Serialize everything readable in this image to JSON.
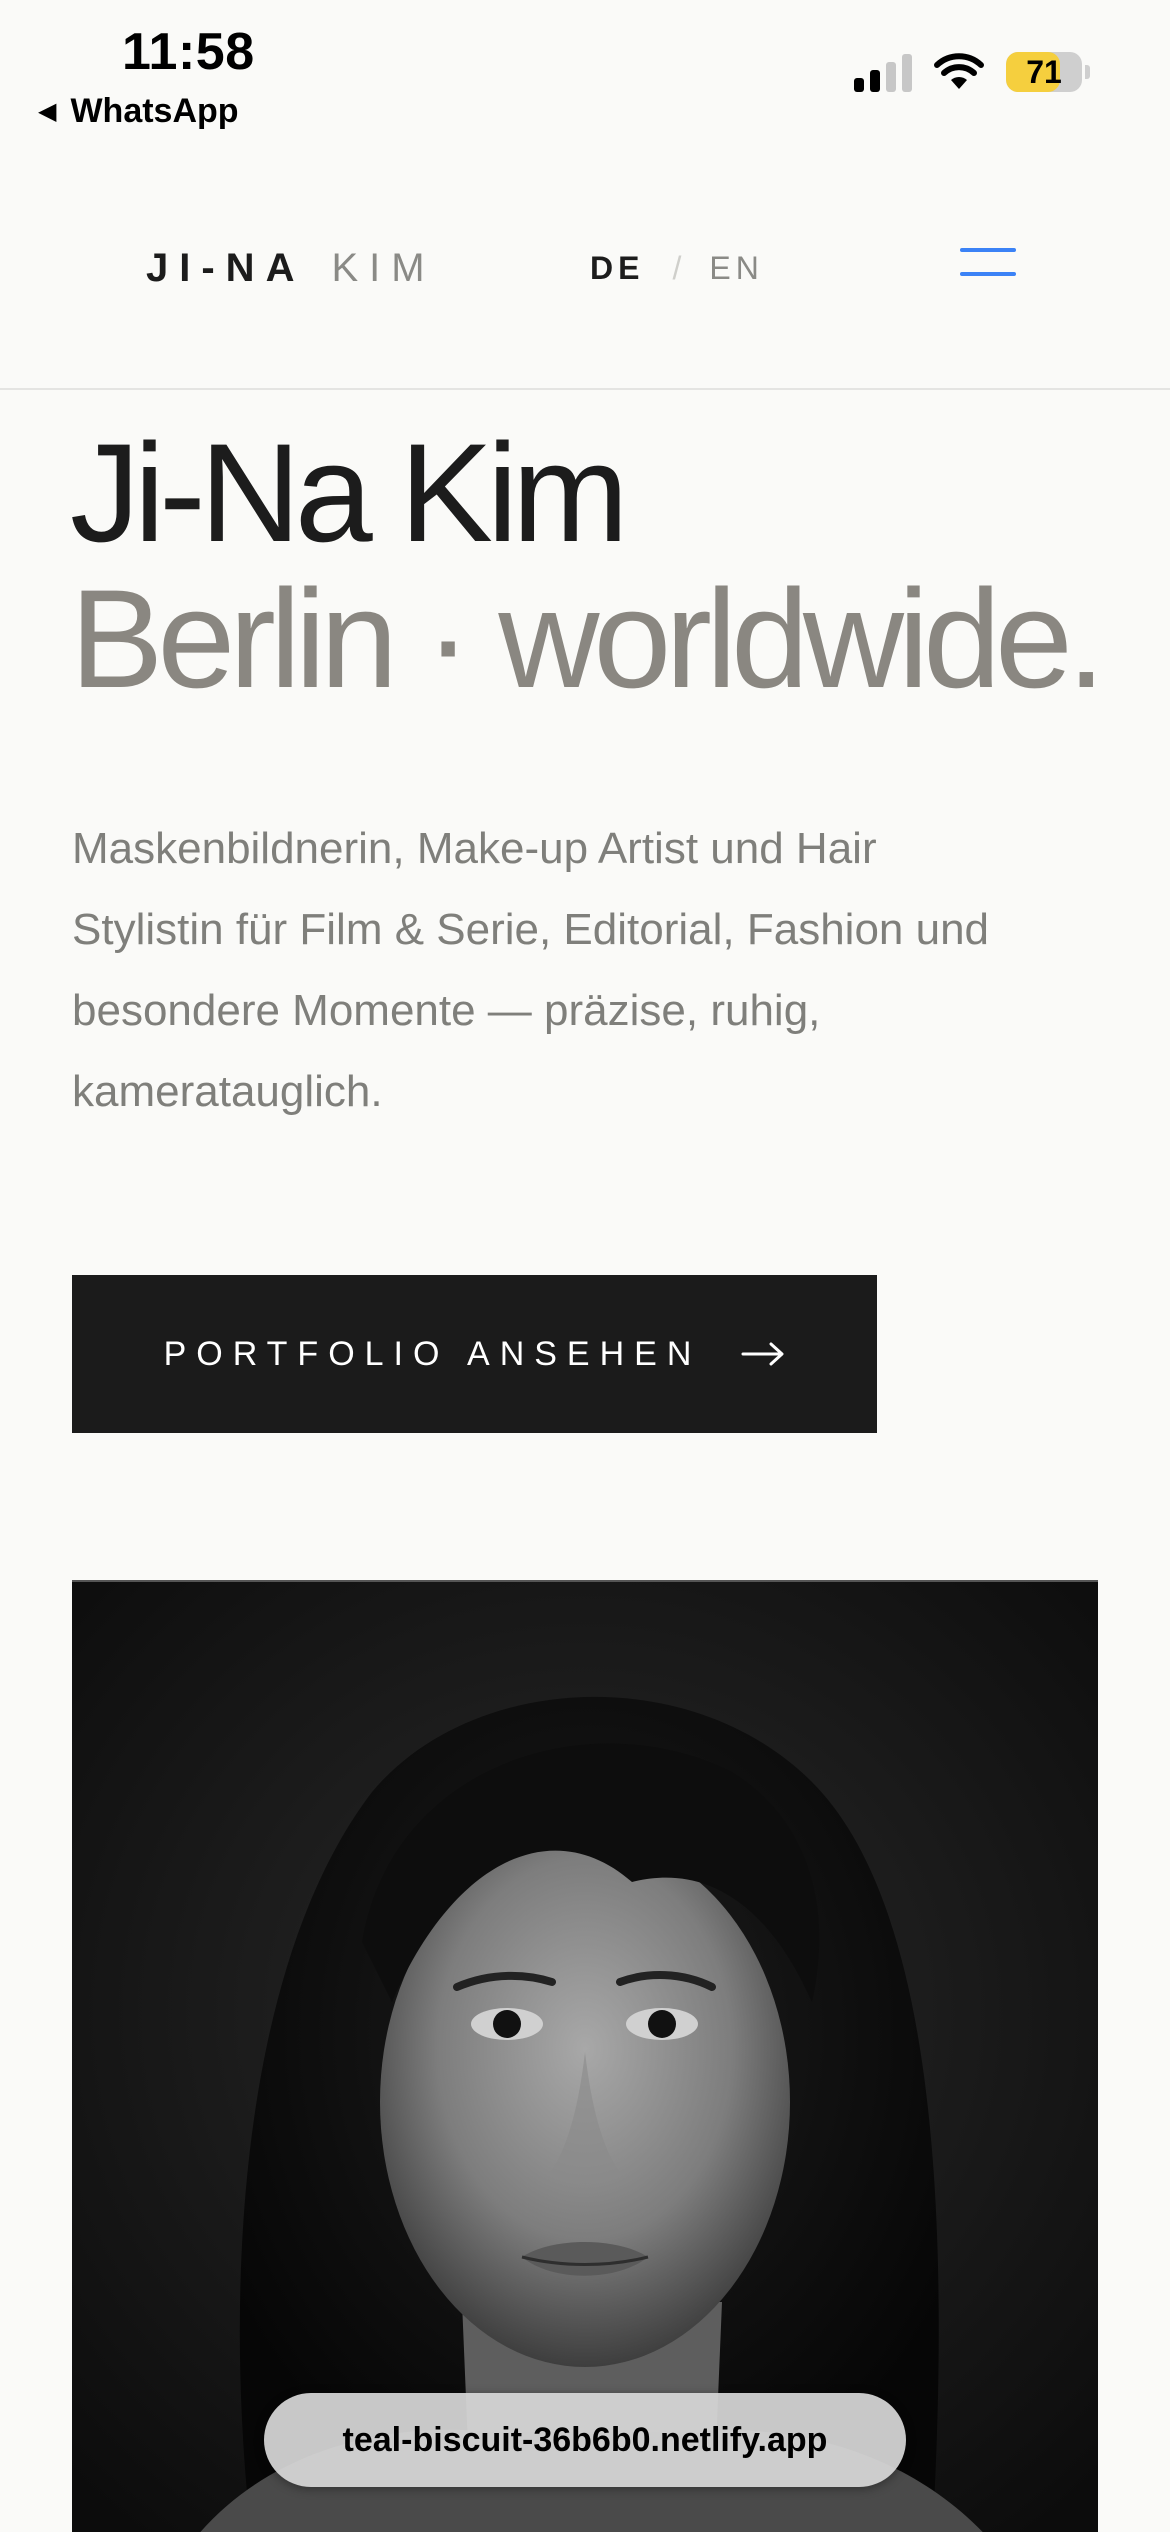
{
  "status_bar": {
    "time": "11:58",
    "back_app": "WhatsApp",
    "battery_level": "71",
    "battery_fraction": 0.71,
    "battery_color": "#f5cf3e",
    "signal_bars_active": 2,
    "signal_bars_total": 4,
    "icons": [
      "signal-icon",
      "wifi-icon",
      "battery-icon",
      "back-triangle-icon"
    ]
  },
  "header": {
    "logo_first": "JI-NA",
    "logo_last": "KIM",
    "lang_active": "DE",
    "lang_separator": "/",
    "lang_inactive": "EN",
    "menu_icon": "hamburger-menu-icon",
    "accent_color": "#3b82f6"
  },
  "hero": {
    "title_line1": "Ji-Na Kim",
    "title_line2": "Berlin · worldwide.",
    "description": "Maskenbildnerin, Make-up Artist und Hair Stylistin für Film & Serie, Editorial, Fashion und besondere Momente — präzise, ruhig, kameratauglich.",
    "cta_label": "PORTFOLIO ANSEHEN",
    "cta_icon": "arrow-right-icon"
  },
  "portrait": {
    "kind": "black-and-white portrait photograph"
  },
  "browser": {
    "url": "teal-biscuit-36b6b0.netlify.app"
  }
}
